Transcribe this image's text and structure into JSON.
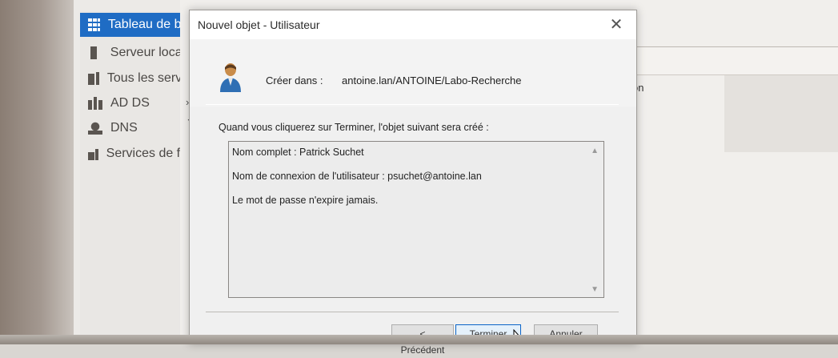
{
  "sidebar": {
    "items": [
      {
        "label": "Tableau de bord",
        "icon": "dashboard-grid-icon"
      },
      {
        "label": "Serveur local",
        "icon": "server-icon"
      },
      {
        "label": "Tous les serveurs",
        "icon": "servers-icon"
      },
      {
        "label": "AD DS",
        "icon": "ad-ds-icon"
      },
      {
        "label": "DNS",
        "icon": "dns-icon"
      },
      {
        "label": "Services de fichiers",
        "icon": "file-services-icon"
      }
    ],
    "active_color": "#1f6cc4"
  },
  "background": {
    "column_fragment": "on"
  },
  "dialog": {
    "title": "Nouvel objet - Utilisateur",
    "create_in_label": "Créer dans :",
    "create_in_path": "antoine.lan/ANTOINE/Labo-Recherche",
    "info_text": "Quand vous cliquerez sur Terminer, l'objet suivant sera créé :",
    "summary": {
      "full_name": "Nom complet : Patrick Suchet",
      "logon_name": "Nom de connexion de l'utilisateur : psuchet@antoine.lan",
      "password_note": "Le mot de passe n'expire jamais."
    },
    "buttons": {
      "previous": "< Précédent",
      "finish": "Terminer",
      "cancel": "Annuler"
    },
    "close_glyph": "✕"
  }
}
